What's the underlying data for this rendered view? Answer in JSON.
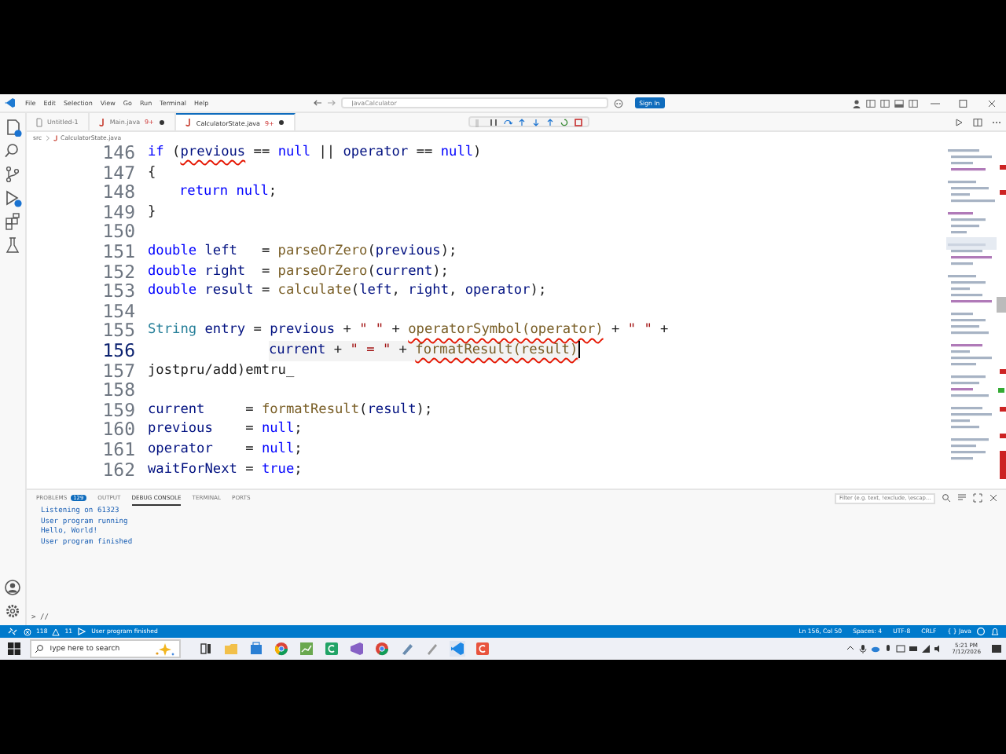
{
  "menu": [
    "File",
    "Edit",
    "Selection",
    "View",
    "Go",
    "Run",
    "Terminal",
    "Help"
  ],
  "command_center": {
    "placeholder": "JavaCalculator"
  },
  "sign_in": "Sign In",
  "tabs": [
    {
      "label": "Untitled-1",
      "modified": false,
      "selected": false
    },
    {
      "label": "Main.java",
      "badge": "9+",
      "modified": true,
      "selected": false
    },
    {
      "label": "CalculatorState.java",
      "badge": "9+",
      "modified": true,
      "selected": true
    }
  ],
  "breadcrumb": [
    "src",
    "CalculatorState.java"
  ],
  "lines": [
    {
      "number": "146",
      "current": false,
      "kind": "statement",
      "tokens": [
        {
          "text": "if",
          "kind": "keyword"
        },
        {
          "text": " ("
        },
        {
          "text": "previous",
          "kind": "variable",
          "squiggle": true
        },
        {
          "text": " == "
        },
        {
          "text": "null",
          "kind": "keyword"
        },
        {
          "text": " || "
        },
        {
          "text": "operator",
          "kind": "variable"
        },
        {
          "text": " == "
        },
        {
          "text": "null",
          "kind": "keyword"
        },
        {
          "text": ")"
        }
      ]
    },
    {
      "number": "147",
      "current": false,
      "kind": "statement",
      "tokens": [
        {
          "text": "{"
        }
      ]
    },
    {
      "number": "148",
      "current": false,
      "kind": "nested",
      "tokens": [
        {
          "text": "return",
          "kind": "keyword"
        },
        {
          "text": " null",
          "kind": "keyword"
        },
        {
          "text": ";"
        }
      ]
    },
    {
      "number": "149",
      "current": false,
      "kind": "statement",
      "tokens": [
        {
          "text": "}"
        }
      ]
    },
    {
      "number": "150",
      "current": false
    },
    {
      "number": "151",
      "current": false,
      "kind": "statement",
      "tokens": [
        {
          "text": "double",
          "kind": "keyword"
        },
        {
          "text": " left",
          "kind": "variable"
        },
        {
          "text": "   = "
        },
        {
          "text": "parseOrZero",
          "kind": "function"
        },
        {
          "text": "("
        },
        {
          "text": "previous",
          "kind": "variable"
        },
        {
          "text": ");"
        }
      ]
    },
    {
      "number": "152",
      "current": false,
      "kind": "statement",
      "tokens": [
        {
          "text": "double",
          "kind": "keyword"
        },
        {
          "text": " right",
          "kind": "variable"
        },
        {
          "text": "  = "
        },
        {
          "text": "parseOrZero",
          "kind": "function"
        },
        {
          "text": "("
        },
        {
          "text": "current",
          "kind": "variable"
        },
        {
          "text": ");"
        }
      ]
    },
    {
      "number": "153",
      "current": false,
      "kind": "statement",
      "tokens": [
        {
          "text": "double",
          "kind": "keyword"
        },
        {
          "text": " result",
          "kind": "variable"
        },
        {
          "text": " = "
        },
        {
          "text": "calculate",
          "kind": "function"
        },
        {
          "text": "("
        },
        {
          "text": "left",
          "kind": "variable"
        },
        {
          "text": ", "
        },
        {
          "text": "right",
          "kind": "variable"
        },
        {
          "text": ", "
        },
        {
          "text": "operator",
          "kind": "variable"
        },
        {
          "text": ");"
        }
      ]
    },
    {
      "number": "154",
      "current": false
    },
    {
      "number": "155",
      "current": false,
      "kind": "statement",
      "tokens": [
        {
          "text": "String",
          "kind": "type"
        },
        {
          "text": " entry",
          "kind": "variable"
        },
        {
          "text": " = "
        },
        {
          "text": "previous",
          "kind": "variable"
        },
        {
          "text": " + "
        },
        {
          "text": "\" \"",
          "kind": "string"
        },
        {
          "text": " + "
        },
        {
          "text": "operatorSymbol(operator)",
          "kind": "function",
          "squiggle": true
        },
        {
          "text": " + "
        },
        {
          "text": "\" \"",
          "kind": "string"
        },
        {
          "text": " +"
        }
      ]
    },
    {
      "number": "156",
      "current": true,
      "kind": "continuation",
      "tokens": [
        {
          "text": "current",
          "kind": "variable"
        },
        {
          "text": " + "
        },
        {
          "text": "\" = \"",
          "kind": "string"
        },
        {
          "text": " + "
        },
        {
          "text": "formatResult(result)",
          "kind": "function",
          "squiggle": true
        }
      ]
    },
    {
      "number": "157",
      "current": false,
      "kind": "statement",
      "tokens": [
        {
          "text": "jostpru/add)emtru_"
        }
      ]
    },
    {
      "number": "158",
      "current": false
    },
    {
      "number": "159",
      "current": false,
      "kind": "statement",
      "tokens": [
        {
          "text": "current",
          "kind": "variable"
        },
        {
          "text": "     = "
        },
        {
          "text": "formatResult",
          "kind": "function"
        },
        {
          "text": "("
        },
        {
          "text": "result",
          "kind": "variable"
        },
        {
          "text": ");"
        }
      ]
    },
    {
      "number": "160",
      "current": false,
      "kind": "statement",
      "tokens": [
        {
          "text": "previous",
          "kind": "variable"
        },
        {
          "text": "    = "
        },
        {
          "text": "null",
          "kind": "keyword"
        },
        {
          "text": ";"
        }
      ]
    },
    {
      "number": "161",
      "current": false,
      "kind": "statement",
      "tokens": [
        {
          "text": "operator",
          "kind": "variable"
        },
        {
          "text": "    = "
        },
        {
          "text": "null",
          "kind": "keyword"
        },
        {
          "text": ";"
        }
      ]
    },
    {
      "number": "162",
      "current": false,
      "kind": "statement",
      "tokens": [
        {
          "text": "waitForNext",
          "kind": "variable"
        },
        {
          "text": " = "
        },
        {
          "text": "true",
          "kind": "keyword"
        },
        {
          "text": ";"
        }
      ]
    }
  ],
  "panel_tabs": [
    {
      "label": "PROBLEMS",
      "badge": "129",
      "selected": false
    },
    {
      "label": "OUTPUT",
      "selected": false
    },
    {
      "label": "DEBUG CONSOLE",
      "selected": true
    },
    {
      "label": "TERMINAL",
      "selected": false
    },
    {
      "label": "PORTS",
      "selected": false
    }
  ],
  "filter": {
    "placeholder": "Filter (e.g. text, !exclude, \\escap…"
  },
  "console": [
    "Listening on 61323",
    "User program running",
    "Hello, World!",
    "User program finished"
  ],
  "console_input": "> //",
  "status_left": {
    "errors": "118",
    "warnings": "11",
    "message": "User program finished"
  },
  "status_right": [
    "Ln 156, Col 50",
    "Spaces: 4",
    "UTF-8",
    "CRLF",
    "{ } Java"
  ],
  "taskbar": {
    "search": {
      "placeholder": "Type here to search"
    },
    "time": "5:21 PM",
    "date": "7/12/2026"
  }
}
